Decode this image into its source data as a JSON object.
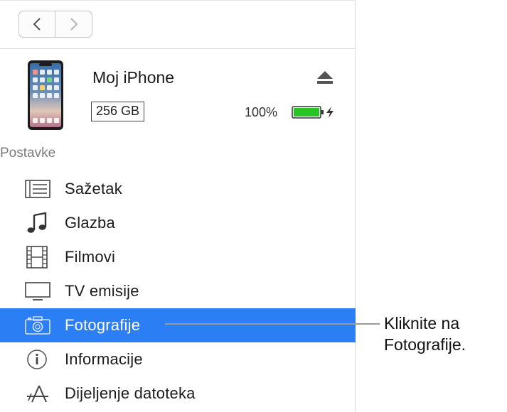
{
  "nav": {
    "back_icon": "chevron-left-icon",
    "forward_icon": "chevron-right-icon"
  },
  "device": {
    "name": "Moj iPhone",
    "capacity": "256 GB",
    "battery_percent": "100%",
    "battery_level": 1.0,
    "battery_color": "#28c423",
    "eject_icon": "eject-icon"
  },
  "section": {
    "title": "Postavke"
  },
  "menu": {
    "items": [
      {
        "label": "Sažetak",
        "icon": "summary-list-icon"
      },
      {
        "label": "Glazba",
        "icon": "music-note-icon"
      },
      {
        "label": "Filmovi",
        "icon": "film-icon"
      },
      {
        "label": "TV emisije",
        "icon": "tv-icon"
      },
      {
        "label": "Fotografije",
        "icon": "camera-icon",
        "selected": true
      },
      {
        "label": "Informacije",
        "icon": "info-icon"
      },
      {
        "label": "Dijeljenje datoteka",
        "icon": "file-sharing-icon"
      }
    ],
    "selected_color": "#2c7ef5"
  },
  "callout": {
    "line1": "Kliknite na",
    "line2": "Fotografije."
  }
}
